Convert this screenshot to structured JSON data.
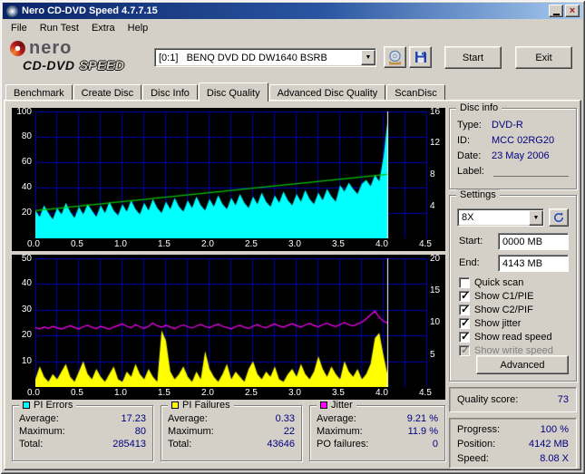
{
  "window": {
    "title": "Nero CD-DVD Speed 4.7.7.15"
  },
  "menu": {
    "items": [
      "File",
      "Run Test",
      "Extra",
      "Help"
    ]
  },
  "branding": {
    "name": "nero",
    "product_line1": "CD-DVD",
    "product_line2": "SPEED"
  },
  "toolbar": {
    "drive": "[0:1]   BENQ DVD DD DW1640 BSRB",
    "start": "Start",
    "exit": "Exit"
  },
  "tabs": {
    "items": [
      "Benchmark",
      "Create Disc",
      "Disc Info",
      "Disc Quality",
      "Advanced Disc Quality",
      "ScanDisc"
    ],
    "active": "Disc Quality"
  },
  "disc_info": {
    "title": "Disc info",
    "type_label": "Type:",
    "type": "DVD-R",
    "id_label": "ID:",
    "id": "MCC 02RG20",
    "date_label": "Date:",
    "date": "23 May 2006",
    "label_label": "Label:",
    "label": ""
  },
  "settings": {
    "title": "Settings",
    "speed": "8X",
    "start_label": "Start:",
    "start": "0000 MB",
    "end_label": "End:",
    "end": "4143 MB",
    "checkboxes": [
      {
        "label": "Quick scan",
        "checked": false,
        "enabled": true
      },
      {
        "label": "Show C1/PIE",
        "checked": true,
        "enabled": true
      },
      {
        "label": "Show C2/PIF",
        "checked": true,
        "enabled": true
      },
      {
        "label": "Show jitter",
        "checked": true,
        "enabled": true
      },
      {
        "label": "Show read speed",
        "checked": true,
        "enabled": true
      },
      {
        "label": "Show write speed",
        "checked": true,
        "enabled": false
      }
    ],
    "advanced": "Advanced"
  },
  "quality": {
    "label": "Quality score:",
    "value": "73"
  },
  "progress": {
    "progress_label": "Progress:",
    "progress": "100 %",
    "position_label": "Position:",
    "position": "4142 MB",
    "speed_label": "Speed:",
    "speed": "8.08 X"
  },
  "stats": {
    "pi_errors": {
      "title": "PI Errors",
      "color": "#00ffff",
      "rows": [
        [
          "Average:",
          "17.23"
        ],
        [
          "Maximum:",
          "80"
        ],
        [
          "Total:",
          "285413"
        ]
      ]
    },
    "pi_failures": {
      "title": "PI Failures",
      "color": "#ffff00",
      "rows": [
        [
          "Average:",
          "0.33"
        ],
        [
          "Maximum:",
          "22"
        ],
        [
          "Total:",
          "43646"
        ]
      ]
    },
    "jitter": {
      "title": "Jitter",
      "color": "#ff00ff",
      "rows": [
        [
          "Average:",
          "9.21 %"
        ],
        [
          "Maximum:",
          "11.9 %"
        ],
        [
          "PO failures:",
          "0"
        ]
      ]
    }
  },
  "chart_data": [
    {
      "type": "area",
      "title": "PI Errors vs position with read speed",
      "bg": "#000000",
      "grid_color": "#0000b4",
      "x_min": 0,
      "x_max": 4.5,
      "x_step": 0.05,
      "cursor_x": 4.04,
      "x_ticks": [
        "0.0",
        "0.5",
        "1.0",
        "1.5",
        "2.0",
        "2.5",
        "3.0",
        "3.5",
        "4.0",
        "4.5"
      ],
      "y_left_max": 100,
      "y_left_ticks": [
        20,
        40,
        60,
        80,
        100
      ],
      "y_right_max": 16,
      "y_right_ticks": [
        4,
        8,
        12,
        16
      ],
      "fill_series": {
        "name": "PI Errors (C1/PIE)",
        "color": "#00ffff",
        "values": [
          22,
          17,
          26,
          20,
          15,
          24,
          19,
          28,
          21,
          16,
          25,
          19,
          27,
          22,
          17,
          26,
          20,
          29,
          22,
          18,
          27,
          21,
          30,
          23,
          19,
          28,
          22,
          31,
          24,
          20,
          29,
          23,
          32,
          25,
          21,
          30,
          24,
          33,
          26,
          22,
          31,
          25,
          34,
          27,
          23,
          32,
          26,
          35,
          28,
          24,
          33,
          27,
          36,
          29,
          25,
          34,
          28,
          37,
          30,
          26,
          35,
          29,
          38,
          31,
          27,
          36,
          30,
          39,
          33,
          29,
          42,
          37,
          44,
          39,
          35,
          43,
          46,
          41,
          50,
          45,
          65,
          96
        ]
      },
      "line_series": [
        {
          "name": "read speed",
          "color": "#00c800",
          "points": [
            [
              0,
              21.9
            ],
            [
              4.04,
              50.5
            ]
          ]
        }
      ]
    },
    {
      "type": "area",
      "title": "PI Failures vs position with jitter",
      "bg": "#000000",
      "grid_color": "#0000b4",
      "x_min": 0,
      "x_max": 4.5,
      "x_step": 0.05,
      "cursor_x": 4.04,
      "x_ticks": [
        "0.0",
        "0.5",
        "1.0",
        "1.5",
        "2.0",
        "2.5",
        "3.0",
        "3.5",
        "4.0",
        "4.5"
      ],
      "y_left_max": 50,
      "y_left_ticks": [
        10,
        20,
        30,
        40,
        50
      ],
      "y_right_max": 20,
      "y_right_ticks": [
        5,
        10,
        15,
        20
      ],
      "fill_series": {
        "name": "PI Failures (C2/PIF)",
        "color": "#ffff00",
        "values": [
          3,
          8,
          4,
          2,
          5,
          3,
          6,
          9,
          4,
          2,
          6,
          10,
          5,
          3,
          7,
          4,
          2,
          5,
          8,
          3,
          2,
          6,
          4,
          9,
          5,
          3,
          7,
          4,
          2,
          22,
          18,
          6,
          3,
          5,
          8,
          4,
          2,
          6,
          3,
          14,
          7,
          4,
          2,
          5,
          9,
          3,
          6,
          4,
          2,
          7,
          10,
          5,
          3,
          6,
          4,
          8,
          3,
          2,
          5,
          7,
          4,
          9,
          5,
          3,
          6,
          12,
          7,
          4,
          8,
          5,
          3,
          10,
          6,
          4,
          7,
          3,
          5,
          9,
          19,
          21,
          12,
          4
        ]
      },
      "line_series": [
        {
          "name": "jitter",
          "color": "#ff00ff",
          "values": [
            23.0,
            22.6,
            23.3,
            22.8,
            23.5,
            23.0,
            22.5,
            23.2,
            23.8,
            23.1,
            22.6,
            23.4,
            24.0,
            23.2,
            22.7,
            23.5,
            23.0,
            22.5,
            23.3,
            23.9,
            24.5,
            23.6,
            23.0,
            24.2,
            23.4,
            22.8,
            23.6,
            24.8,
            23.8,
            23.2,
            24.0,
            23.3,
            22.7,
            23.5,
            24.1,
            23.4,
            22.9,
            23.7,
            24.3,
            23.5,
            23.0,
            23.8,
            24.4,
            23.6,
            23.1,
            22.6,
            23.4,
            24.0,
            23.2,
            22.8,
            23.6,
            24.2,
            23.4,
            23.0,
            23.8,
            24.5,
            23.7,
            23.2,
            24.0,
            24.6,
            23.8,
            23.3,
            24.1,
            24.7,
            23.9,
            23.4,
            24.2,
            24.8,
            24.0,
            23.5,
            24.3,
            25.0,
            24.2,
            23.7,
            24.5,
            25.2,
            26.5,
            28.0,
            29.5,
            27.0,
            25.5,
            24.8
          ]
        }
      ]
    }
  ]
}
